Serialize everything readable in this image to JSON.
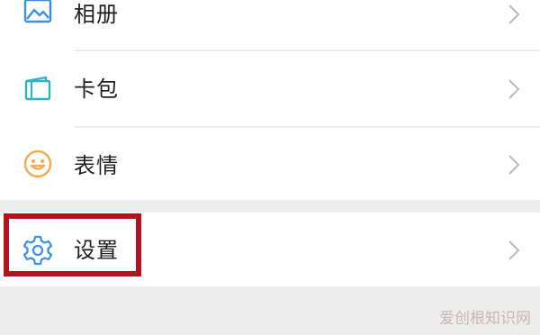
{
  "menu": {
    "items": [
      {
        "label": "相册",
        "icon": "photo-album-icon"
      },
      {
        "label": "卡包",
        "icon": "card-wallet-icon"
      },
      {
        "label": "表情",
        "icon": "sticker-smiley-icon"
      },
      {
        "label": "设置",
        "icon": "gear-icon"
      }
    ]
  },
  "annotation": {
    "highlight_color": "#b2131d",
    "highlighted_item": "设置"
  },
  "watermark": {
    "text": "爱创根知识网"
  },
  "colors": {
    "icon_blue": "#3a8fe6",
    "card_teal": "#2bb3c9",
    "smiley_orange": "#f5a94b",
    "divider": "#ececec",
    "section_gap": "#ededed",
    "chevron": "#b9b9b9"
  }
}
